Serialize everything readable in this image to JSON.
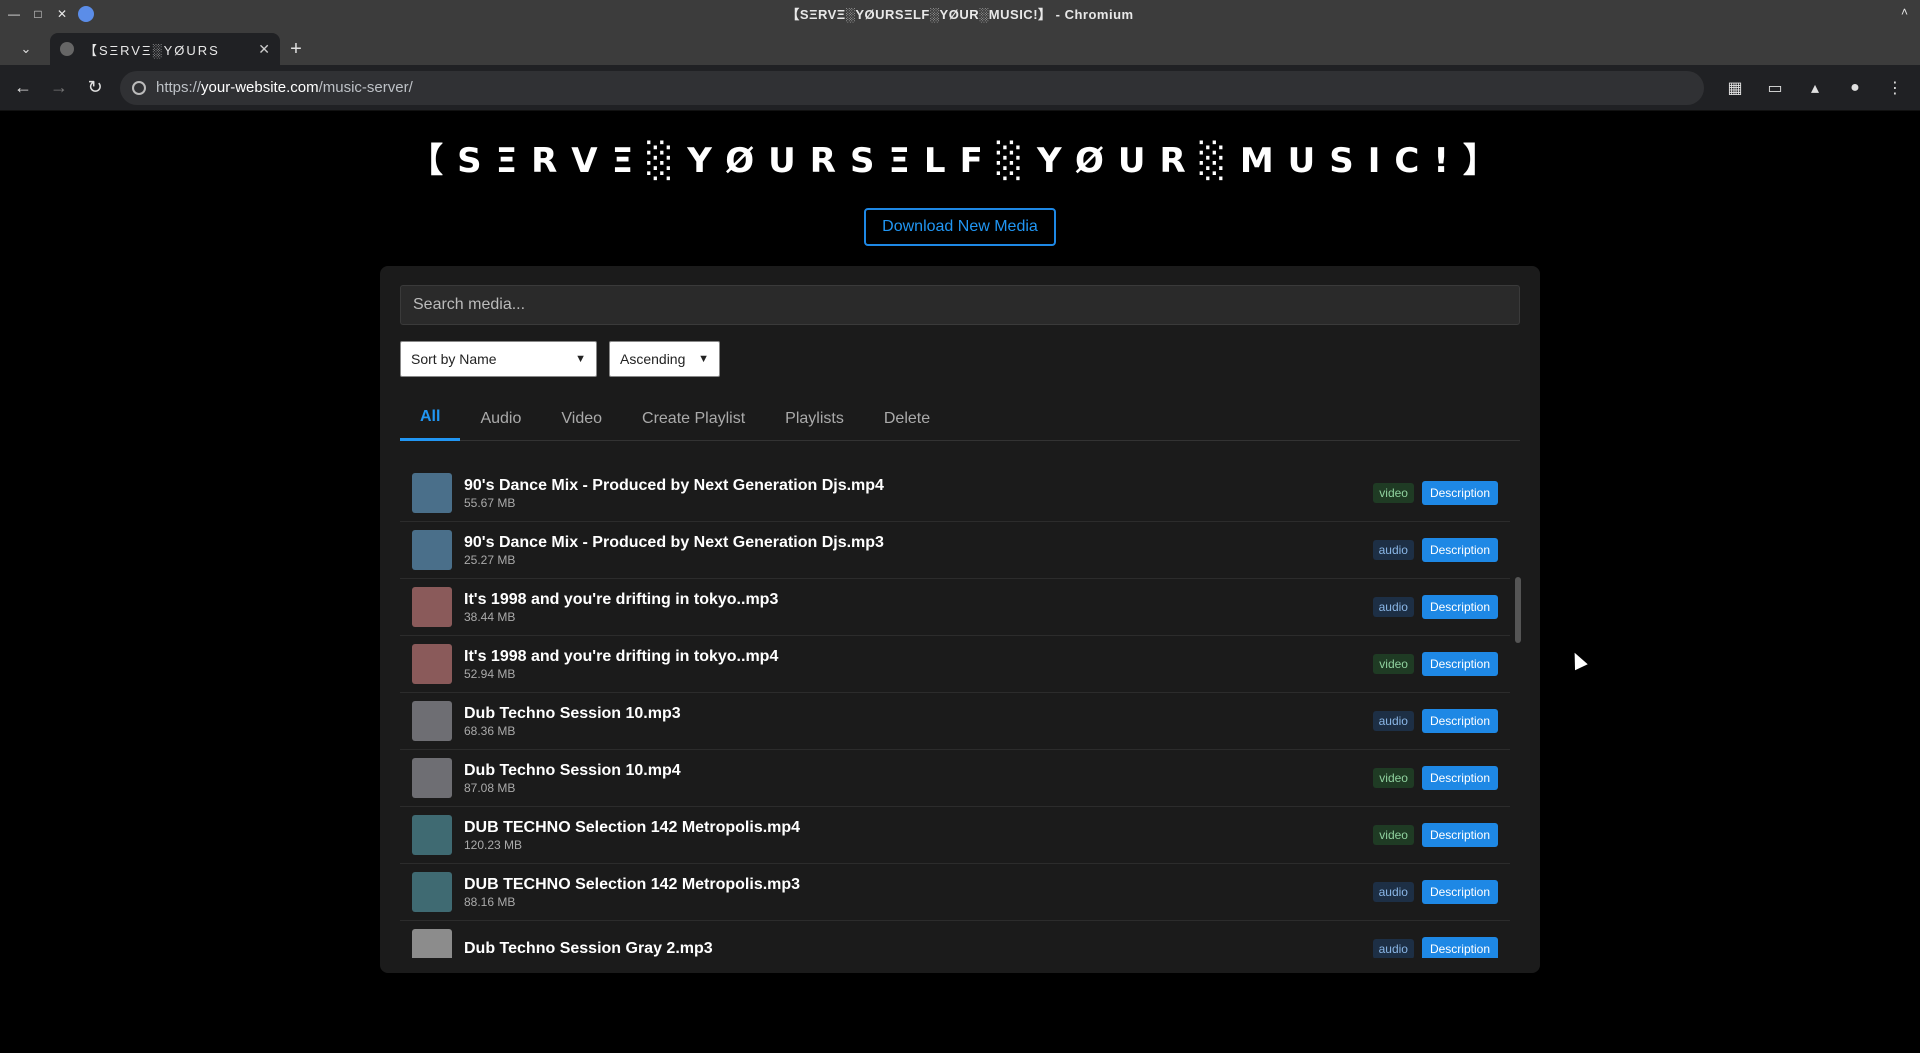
{
  "window": {
    "title": "【SΞRVΞ░YØURSΞLF░YØUR░MUSIC!】 - Chromium"
  },
  "browser": {
    "tab_title": "【SΞRVΞ░YØURS",
    "url_prefix": "https://",
    "url_host": "your-website.com",
    "url_path": "/music-server/"
  },
  "page": {
    "site_title": "【SΞRVΞ░YØURSΞLF░YØUR░MUSIC!】",
    "download_button": "Download New Media",
    "search_placeholder": "Search media...",
    "sort_select": "Sort by Name",
    "order_select": "Ascending",
    "tabs": [
      "All",
      "Audio",
      "Video",
      "Create Playlist",
      "Playlists",
      "Delete"
    ],
    "active_tab": "All",
    "description_label": "Description"
  },
  "media": [
    {
      "name": "90's Dance Mix - Produced by Next Generation Djs.mp4",
      "size": "55.67 MB",
      "type": "video",
      "thumb_color": "#4a6f8a"
    },
    {
      "name": "90's Dance Mix - Produced by Next Generation Djs.mp3",
      "size": "25.27 MB",
      "type": "audio",
      "thumb_color": "#4a6f8a"
    },
    {
      "name": "It's 1998 and you're drifting in tokyo..mp3",
      "size": "38.44 MB",
      "type": "audio",
      "thumb_color": "#8a5a5a"
    },
    {
      "name": "It's 1998 and you're drifting in tokyo..mp4",
      "size": "52.94 MB",
      "type": "video",
      "thumb_color": "#8a5a5a"
    },
    {
      "name": "Dub Techno Session 10.mp3",
      "size": "68.36 MB",
      "type": "audio",
      "thumb_color": "#6e6e73"
    },
    {
      "name": "Dub Techno Session 10.mp4",
      "size": "87.08 MB",
      "type": "video",
      "thumb_color": "#6e6e73"
    },
    {
      "name": "DUB TECHNO Selection 142 Metropolis.mp4",
      "size": "120.23 MB",
      "type": "video",
      "thumb_color": "#3f6a72"
    },
    {
      "name": "DUB TECHNO Selection 142 Metropolis.mp3",
      "size": "88.16 MB",
      "type": "audio",
      "thumb_color": "#3f6a72"
    },
    {
      "name": "Dub Techno Session Gray 2.mp3",
      "size": "",
      "type": "audio",
      "thumb_color": "#8c8c8c"
    }
  ]
}
